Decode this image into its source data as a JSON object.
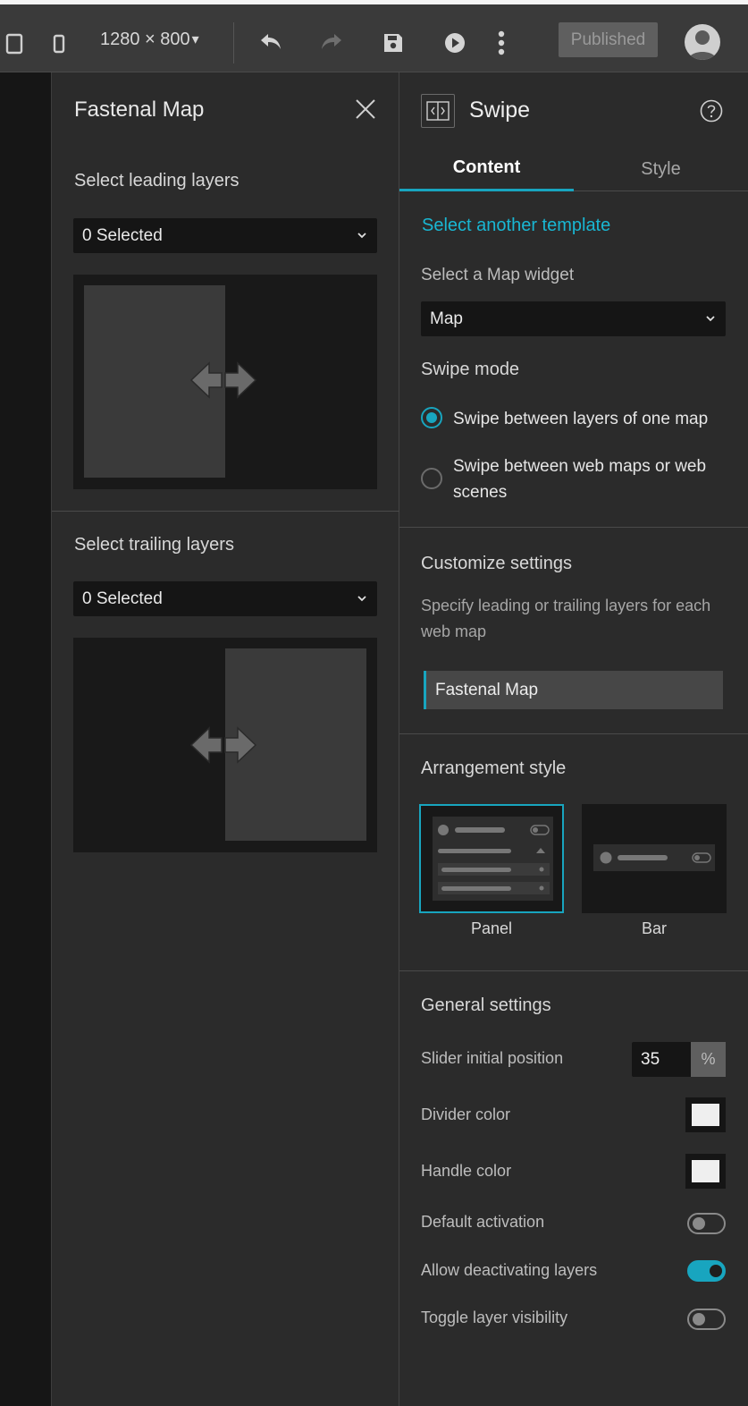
{
  "toolbar": {
    "resolution": "1280 × 800",
    "resolution_caret": "▾",
    "published_label": "Published"
  },
  "layer_panel": {
    "title": "Fastenal Map",
    "leading": {
      "label": "Select leading layers",
      "value": "0 Selected"
    },
    "trailing": {
      "label": "Select trailing layers",
      "value": "0 Selected"
    }
  },
  "settings": {
    "title": "Swipe",
    "tabs": [
      {
        "label": "Content",
        "active": true
      },
      {
        "label": "Style",
        "active": false
      }
    ],
    "template_link": "Select another template",
    "map_widget": {
      "label": "Select a Map widget",
      "value": "Map"
    },
    "swipe_mode": {
      "label": "Swipe mode",
      "options": [
        {
          "label": "Swipe between layers of one map",
          "checked": true
        },
        {
          "label": "Swipe between web maps or web scenes",
          "checked": false
        }
      ]
    },
    "customize": {
      "heading": "Customize settings",
      "description": "Specify leading or trailing layers for each web map",
      "map_item": "Fastenal Map"
    },
    "arrangement": {
      "heading": "Arrangement style",
      "options": [
        {
          "label": "Panel",
          "selected": true
        },
        {
          "label": "Bar",
          "selected": false
        }
      ]
    },
    "general": {
      "heading": "General settings",
      "slider_label": "Slider initial position",
      "slider_value": "35",
      "slider_unit": "%",
      "divider_color_label": "Divider color",
      "divider_color": "#efefef",
      "handle_color_label": "Handle color",
      "handle_color": "#efefef",
      "toggles": [
        {
          "label": "Default activation",
          "on": false
        },
        {
          "label": "Allow deactivating layers",
          "on": true
        },
        {
          "label": "Toggle layer visibility",
          "on": false
        }
      ]
    }
  },
  "colors": {
    "accent": "#18a5bf",
    "panel": "#2b2b2b",
    "toolbar": "#3a3a3a"
  }
}
